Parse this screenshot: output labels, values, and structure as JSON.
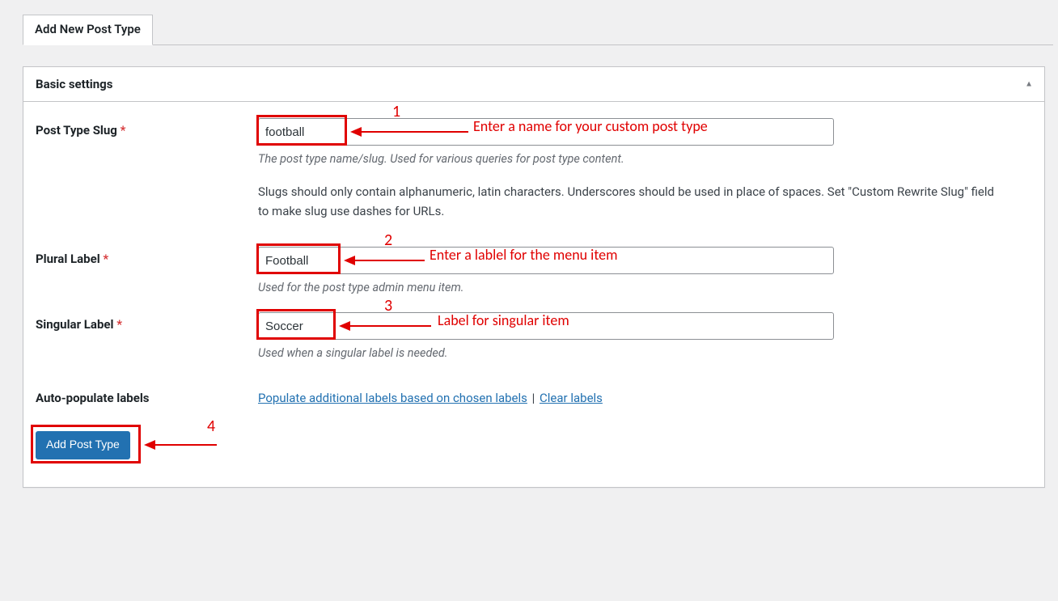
{
  "tab": {
    "label": "Add New Post Type"
  },
  "panel": {
    "title": "Basic settings"
  },
  "fields": {
    "slug": {
      "label": "Post Type Slug",
      "required_marker": "*",
      "value": "football",
      "desc": "The post type name/slug. Used for various queries for post type content.",
      "note": "Slugs should only contain alphanumeric, latin characters. Underscores should be used in place of spaces. Set \"Custom Rewrite Slug\" field to make slug use dashes for URLs."
    },
    "plural": {
      "label": "Plural Label",
      "required_marker": "*",
      "value": "Football",
      "desc": "Used for the post type admin menu item."
    },
    "singular": {
      "label": "Singular Label",
      "required_marker": "*",
      "value": "Soccer",
      "desc": "Used when a singular label is needed."
    },
    "autopop": {
      "label": "Auto-populate labels",
      "link1": "Populate additional labels based on chosen labels",
      "sep": " | ",
      "link2": "Clear labels"
    }
  },
  "button": {
    "label": "Add Post Type"
  },
  "annotations": {
    "n1": "1",
    "t1": "Enter a name for your custom post type",
    "n2": "2",
    "t2": "Enter a lablel for the menu item",
    "n3": "3",
    "t3": "Label for singular item",
    "n4": "4"
  }
}
